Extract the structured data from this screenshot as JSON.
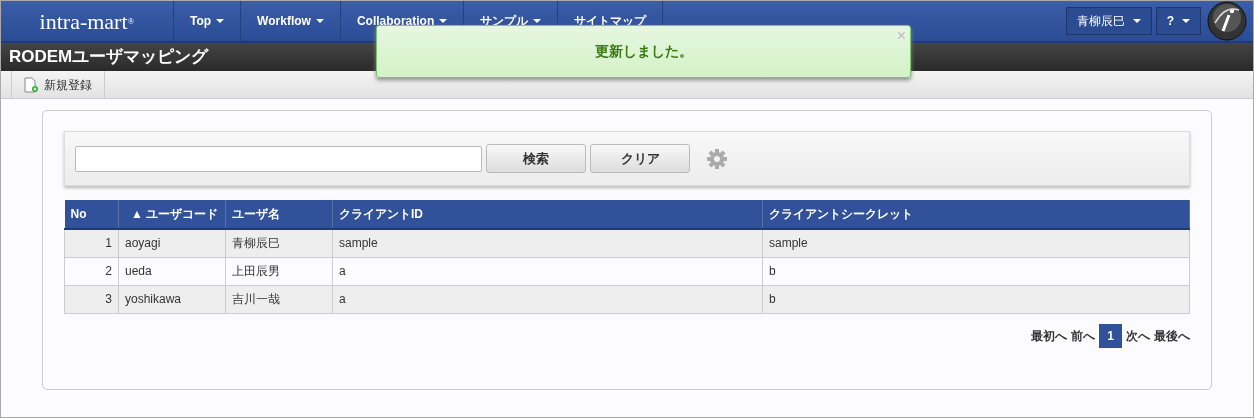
{
  "header": {
    "logo": "intra-mart",
    "logo_mark": "®",
    "nav": [
      {
        "label": "Top",
        "dropdown": true
      },
      {
        "label": "Workflow",
        "dropdown": true
      },
      {
        "label": "Collaboration",
        "dropdown": true
      },
      {
        "label": "サンプル",
        "dropdown": true
      },
      {
        "label": "サイトマップ",
        "dropdown": false
      }
    ],
    "user_menu": "青柳辰巳",
    "help_menu": "?"
  },
  "page_title": "RODEMユーザマッピング",
  "toolbar": [
    {
      "label": "新規登録"
    }
  ],
  "toast": {
    "message": "更新しました。",
    "close": "×"
  },
  "search": {
    "buttons": [
      "検索",
      "クリア"
    ]
  },
  "table": {
    "columns": [
      {
        "label": "No"
      },
      {
        "label": "ユーザコード",
        "sort_icon": "▲"
      },
      {
        "label": "ユーザ名"
      },
      {
        "label": "クライアントID"
      },
      {
        "label": "クライアントシークレット"
      }
    ],
    "rows": [
      [
        "1",
        "aoyagi",
        "青柳辰巳",
        "sample",
        "sample"
      ],
      [
        "2",
        "ueda",
        "上田辰男",
        "a",
        "b"
      ],
      [
        "3",
        "yoshikawa",
        "吉川一哉",
        "a",
        "b"
      ]
    ]
  },
  "pagination": [
    {
      "label": "最初へ",
      "selected": false
    },
    {
      "label": "前へ",
      "selected": false
    },
    {
      "label": "1",
      "selected": true
    },
    {
      "label": "次へ",
      "selected": false
    },
    {
      "label": "最後へ",
      "selected": false
    }
  ]
}
